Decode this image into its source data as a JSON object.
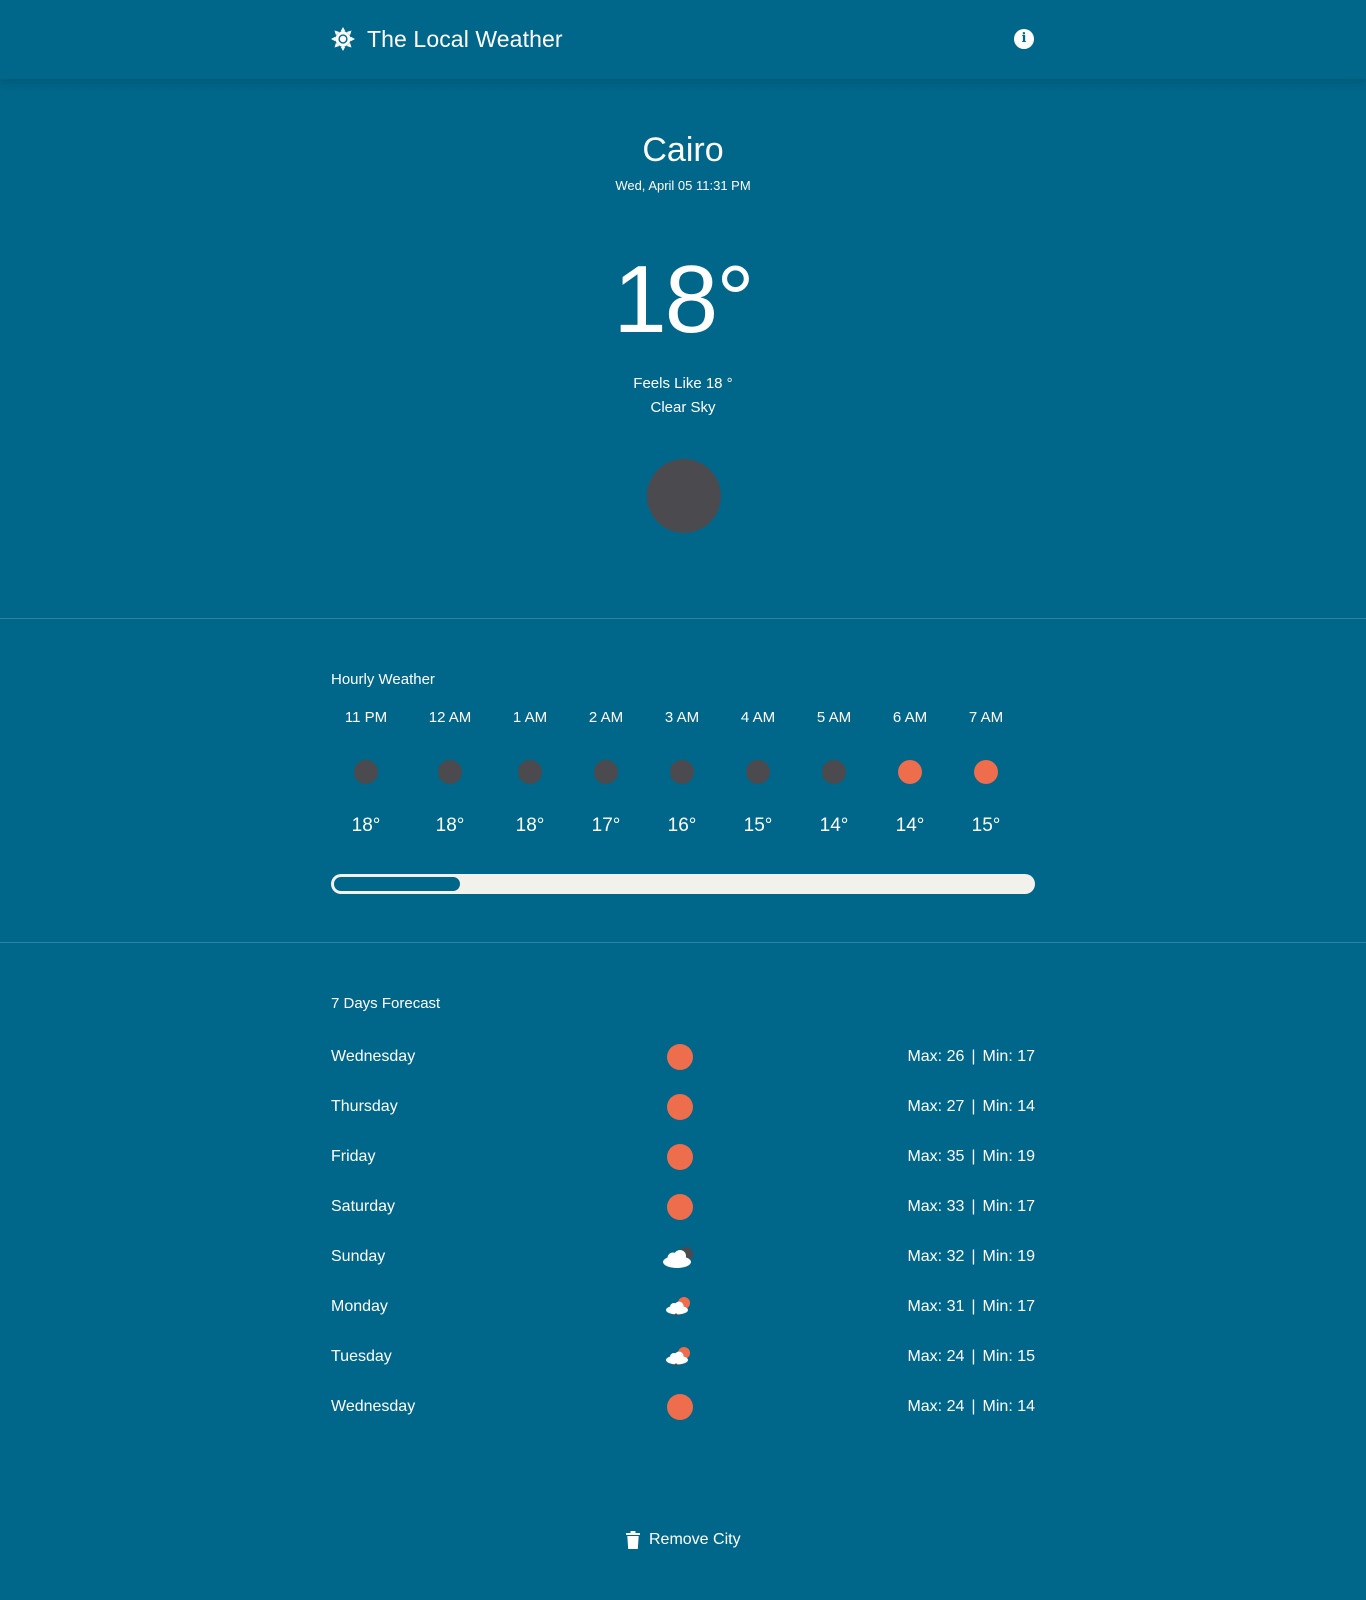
{
  "header": {
    "title": "The Local Weather",
    "logo_icon": "sun-gear-icon",
    "info_icon": "info-icon",
    "info_label": "i"
  },
  "current": {
    "city": "Cairo",
    "datetime": "Wed, April 05 11:31 PM",
    "temperature": "18°",
    "feels_like": "Feels Like 18 °",
    "condition": "Clear Sky",
    "icon": "moon-icon"
  },
  "hourly": {
    "title": "Hourly Weather",
    "items": [
      {
        "time": "11 PM",
        "temp": "18°",
        "icon": "moon-icon"
      },
      {
        "time": "12 AM",
        "temp": "18°",
        "icon": "moon-icon"
      },
      {
        "time": "1 AM",
        "temp": "18°",
        "icon": "moon-icon"
      },
      {
        "time": "2 AM",
        "temp": "17°",
        "icon": "moon-icon"
      },
      {
        "time": "3 AM",
        "temp": "16°",
        "icon": "moon-icon"
      },
      {
        "time": "4 AM",
        "temp": "15°",
        "icon": "moon-icon"
      },
      {
        "time": "5 AM",
        "temp": "14°",
        "icon": "moon-icon"
      },
      {
        "time": "6 AM",
        "temp": "14°",
        "icon": "sun-icon"
      },
      {
        "time": "7 AM",
        "temp": "15°",
        "icon": "sun-icon"
      }
    ],
    "scroll_fraction": 0.18
  },
  "forecast": {
    "title": "7 Days Forecast",
    "days": [
      {
        "day": "Wednesday",
        "max": "Max: 26",
        "min": "Min: 17",
        "icon": "sun-icon"
      },
      {
        "day": "Thursday",
        "max": "Max: 27",
        "min": "Min: 14",
        "icon": "sun-icon"
      },
      {
        "day": "Friday",
        "max": "Max: 35",
        "min": "Min: 19",
        "icon": "sun-icon"
      },
      {
        "day": "Saturday",
        "max": "Max: 33",
        "min": "Min: 17",
        "icon": "sun-icon"
      },
      {
        "day": "Sunday",
        "max": "Max: 32",
        "min": "Min: 19",
        "icon": "cloudy-moon-icon"
      },
      {
        "day": "Monday",
        "max": "Max: 31",
        "min": "Min: 17",
        "icon": "partly-cloudy-icon"
      },
      {
        "day": "Tuesday",
        "max": "Max: 24",
        "min": "Min: 15",
        "icon": "partly-cloudy-icon"
      },
      {
        "day": "Wednesday",
        "max": "Max: 24",
        "min": "Min: 14",
        "icon": "sun-icon"
      }
    ],
    "separator": "|"
  },
  "actions": {
    "remove_label": "Remove City",
    "remove_icon": "trash-icon"
  },
  "colors": {
    "background": "#00668a",
    "sun": "#ee6d4c",
    "moon": "#4b4b4f",
    "scroll_track": "#f3f1ec",
    "text": "#ffffff"
  }
}
